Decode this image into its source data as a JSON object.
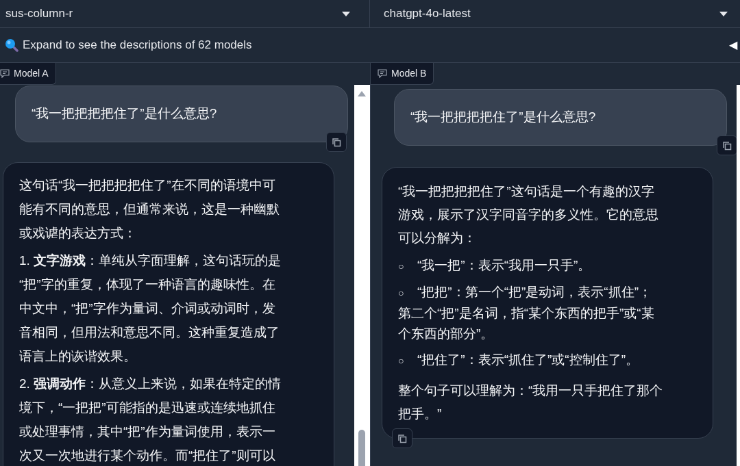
{
  "model_selectors": [
    {
      "value": "sus-column-r"
    },
    {
      "value": "chatgpt-4o-latest"
    }
  ],
  "descriptions_toggle": {
    "label": "Expand to see the descriptions of 62 models",
    "marker": "◀"
  },
  "panels": [
    {
      "label": "Model A",
      "messages": [
        {
          "kind": "user",
          "copy_button": true,
          "blocks": [
            {
              "kind": "paragraph",
              "lines": [
                "“我一把把把把住了”是什么意思?"
              ]
            }
          ]
        },
        {
          "kind": "assistant",
          "copy_button": false,
          "blocks": [
            {
              "kind": "paragraph",
              "lines": [
                "这句话“我一把把把把住了”在不同的语境中可",
                "能有不同的意思，但通常来说，这是一种幽默",
                "或戏谑的表达方式："
              ]
            },
            {
              "kind": "paragraph",
              "lines": [
                "1. **文字游戏**：单纯从字面理解，这句话玩的是",
                "“把”字的重复，体现了一种语言的趣味性。在",
                "中文中，“把”字作为量词、介词或动词时，发",
                "音相同，但用法和意思不同。这种重复造成了",
                "语言上的诙谐效果。"
              ]
            },
            {
              "kind": "paragraph",
              "lines": [
                "2. **强调动作**：从意义上来说，如果在特定的情",
                "境下，“一把把”可能指的是迅速或连续地抓住",
                "或处理事情，其中“把”作为量词使用，表示一",
                "次又一次地进行某个动作。而“把住了”则可以"
              ]
            }
          ]
        }
      ]
    },
    {
      "label": "Model B",
      "messages": [
        {
          "kind": "user",
          "copy_button": true,
          "blocks": [
            {
              "kind": "paragraph",
              "lines": [
                "“我一把把把把住了”是什么意思?"
              ]
            }
          ]
        },
        {
          "kind": "assistant",
          "copy_button": true,
          "blocks": [
            {
              "kind": "paragraph",
              "lines": [
                "“我一把把把把住了”这句话是一个有趣的汉字",
                "游戏，展示了汉字同音字的多义性。它的意思",
                "可以分解为："
              ]
            },
            {
              "kind": "bullet",
              "marker": "○",
              "lines": [
                "“我一把”：表示“我用一只手”。"
              ]
            },
            {
              "kind": "bullet",
              "marker": "○",
              "lines": [
                "“把把”：第一个“把”是动词，表示“抓住”；",
                "第二个“把”是名词，指“某个东西的把手”或“某",
                "个东西的部分”。"
              ]
            },
            {
              "kind": "bullet",
              "marker": "○",
              "lines": [
                "“把住了”：表示“抓住了”或“控制住了”。"
              ]
            },
            {
              "kind": "paragraph",
              "lines": [
                "整个句子可以理解为：“我用一只手把住了那个",
                "把手。”"
              ]
            }
          ]
        }
      ]
    }
  ]
}
